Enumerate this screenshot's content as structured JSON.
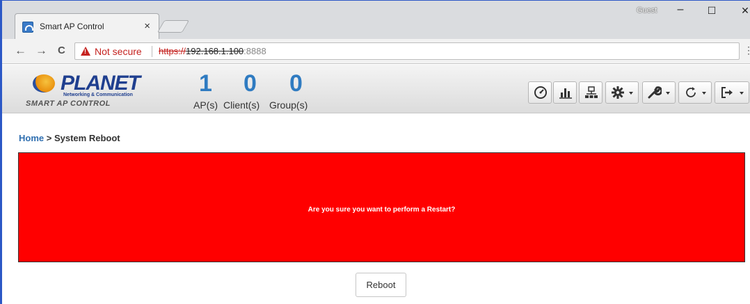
{
  "browser": {
    "tab_title": "Smart AP Control",
    "tab_close": "×",
    "profile": "Guest",
    "window_controls": {
      "minimize": "–",
      "maximize": "☐",
      "close": "✕"
    },
    "nav": {
      "back": "←",
      "forward": "→",
      "reload": "C"
    },
    "security_text": "Not secure",
    "url_scheme": "https://",
    "url_host": "192.168.1.100",
    "url_port": ":8888",
    "menu": "⋮"
  },
  "app": {
    "logo": {
      "name": "PLANET",
      "subtitle": "Networking & Communication",
      "tagline": "SMART AP CONTROL"
    },
    "stats": [
      {
        "value": "1",
        "label": "AP(s)"
      },
      {
        "value": "0",
        "label": "Client(s)"
      },
      {
        "value": "0",
        "label": "Group(s)"
      }
    ],
    "toolbar_icons": [
      "dashboard-icon",
      "bar-chart-icon",
      "network-icon",
      "gear-icon",
      "wrench-icon",
      "refresh-icon",
      "logout-icon"
    ]
  },
  "breadcrumb": {
    "home": "Home",
    "separator": ">",
    "current": "System Reboot"
  },
  "alert": {
    "message": "Are you sure you want to perform a Restart?",
    "color": "#ff0000"
  },
  "actions": {
    "reboot_label": "Reboot"
  },
  "colors": {
    "accent": "#2f7bc1",
    "danger": "#ff0000",
    "warning": "#c5221f"
  }
}
